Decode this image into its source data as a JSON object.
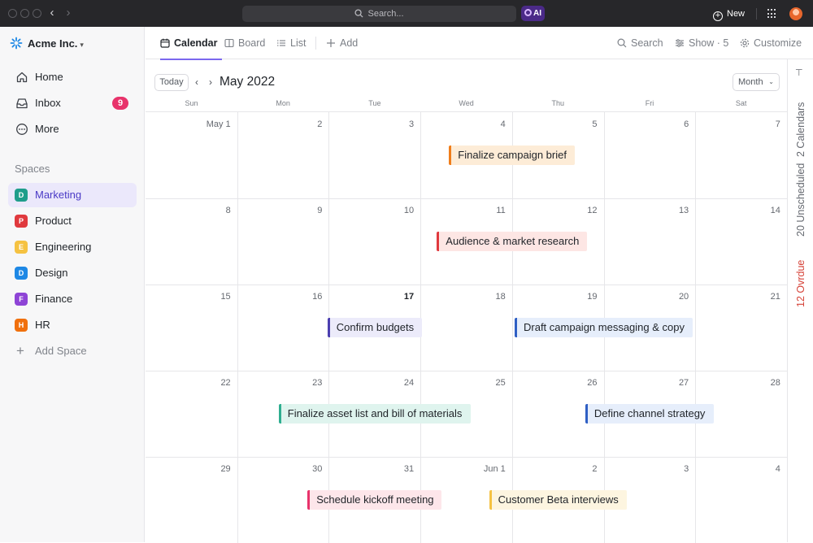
{
  "topbar": {
    "search_placeholder": "Search...",
    "ai_label": "AI",
    "new_label": "New"
  },
  "sidebar": {
    "workspace_name": "Acme Inc.",
    "nav": [
      {
        "label": "Home",
        "icon": "home-icon"
      },
      {
        "label": "Inbox",
        "icon": "inbox-icon",
        "badge": "9"
      },
      {
        "label": "More",
        "icon": "more-icon"
      }
    ],
    "spaces_heading": "Spaces",
    "spaces": [
      {
        "letter": "D",
        "label": "Marketing",
        "color": "#1f9d8b",
        "active": true
      },
      {
        "letter": "P",
        "label": "Product",
        "color": "#e0393e"
      },
      {
        "letter": "E",
        "label": "Engineering",
        "color": "#f5c242"
      },
      {
        "letter": "D",
        "label": "Design",
        "color": "#1e88e5"
      },
      {
        "letter": "F",
        "label": "Finance",
        "color": "#8e44d6"
      },
      {
        "letter": "H",
        "label": "HR",
        "color": "#f0700d"
      }
    ],
    "add_space_label": "Add Space"
  },
  "views": {
    "tabs": [
      "Calendar",
      "Board",
      "List"
    ],
    "add_label": "Add",
    "search_label": "Search",
    "show_label": "Show · 5",
    "customize_label": "Customize"
  },
  "calendar": {
    "today_label": "Today",
    "month_title": "May 2022",
    "view_select": "Month",
    "weekdays": [
      "Sun",
      "Mon",
      "Tue",
      "Wed",
      "Thu",
      "Fri",
      "Sat"
    ],
    "weeks": [
      [
        "May 1",
        "2",
        "3",
        "4",
        "5",
        "6",
        "7"
      ],
      [
        "8",
        "9",
        "10",
        "11",
        "12",
        "13",
        "14"
      ],
      [
        "15",
        "16",
        "17",
        "18",
        "19",
        "20",
        "21"
      ],
      [
        "22",
        "23",
        "24",
        "25",
        "26",
        "27",
        "28"
      ],
      [
        "29",
        "30",
        "31",
        "Jun 1",
        "2",
        "3",
        "4"
      ]
    ],
    "today": "17",
    "events": [
      {
        "title": "Finalize campaign brief",
        "week": 0,
        "start_day": "Wed",
        "end_day": "Thu",
        "color": "#f07d1a",
        "bg": "#fdecd7"
      },
      {
        "title": "Audience & market research",
        "week": 1,
        "start_day": "Wed",
        "end_day": "Thu",
        "color": "#e0393e",
        "bg": "#fde6e4"
      },
      {
        "title": "Confirm budgets",
        "week": 2,
        "start_day": "Tue",
        "end_day": "Tue",
        "color": "#4b3fb0",
        "bg": "#ecebfa"
      },
      {
        "title": "Draft campaign messaging & copy",
        "week": 2,
        "start_day": "Thu",
        "end_day": "Fri",
        "color": "#2f5fc4",
        "bg": "#e6eefb"
      },
      {
        "title": "Finalize asset list and bill of materials",
        "week": 3,
        "start_day": "Mon",
        "end_day": "Wed",
        "color": "#2fae90",
        "bg": "#dff4ee"
      },
      {
        "title": "Define channel strategy",
        "week": 3,
        "start_day": "Fri",
        "end_day": "Fri",
        "color": "#2f5fc4",
        "bg": "#e6eefb"
      },
      {
        "title": "Schedule kickoff meeting",
        "week": 4,
        "start_day": "Tue",
        "end_day": "Tue",
        "color": "#e8336b",
        "bg": "#fde6ea"
      },
      {
        "title": "Customer Beta interviews",
        "week": 4,
        "start_day": "Thu",
        "end_day": "Thu",
        "color": "#f5c242",
        "bg": "#fdf5e0"
      }
    ]
  },
  "rail": {
    "calendars_label": "2 Calendars",
    "unscheduled_label": "20 Unscheduled",
    "overdue_label": "12 Ovrdue"
  }
}
